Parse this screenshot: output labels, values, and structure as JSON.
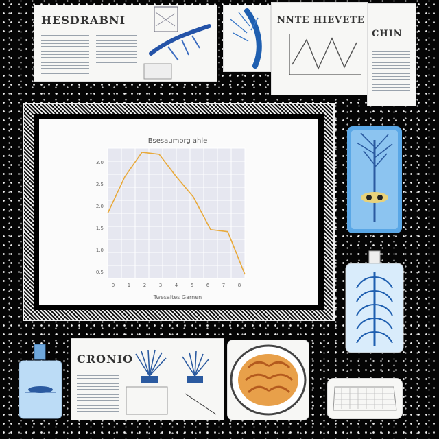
{
  "top_left_card": {
    "heading": "HESDRABNI"
  },
  "top_right_card": {
    "heading": "NNTE HIEVETE",
    "side_label": "CHIN"
  },
  "center_chart": {
    "title": "Bsesaumorg ahle",
    "xlabel": "Twesaltes Garnen",
    "ylabel": "",
    "y_tick_labels": [
      "3.0",
      "2.5",
      "2.0",
      "1.5",
      "1.0",
      "0.5"
    ],
    "x_tick_labels": [
      "0",
      "1",
      "2",
      "3",
      "4",
      "5",
      "6",
      "7",
      "8"
    ]
  },
  "bottom_card": {
    "heading": "CRONIO"
  },
  "chart_data": {
    "type": "line",
    "title": "Bsesaumorg ahle",
    "xlabel": "Twesaltes Garnen",
    "ylabel": "",
    "x": [
      0,
      1,
      2,
      3,
      4,
      5,
      6,
      7,
      8
    ],
    "series": [
      {
        "values": [
          1.6,
          2.5,
          3.1,
          3.05,
          2.5,
          2.0,
          1.2,
          1.15,
          0.1
        ]
      }
    ],
    "xlim": [
      0,
      8
    ],
    "ylim": [
      0,
      3.2
    ],
    "grid": true,
    "line_color": "#e8a93a"
  },
  "colors": {
    "accent_blue": "#1f5fb0",
    "panel_blue": "#5aa7e6",
    "chart_line": "#e8a93a",
    "plot_bg": "#e6e7f0"
  }
}
